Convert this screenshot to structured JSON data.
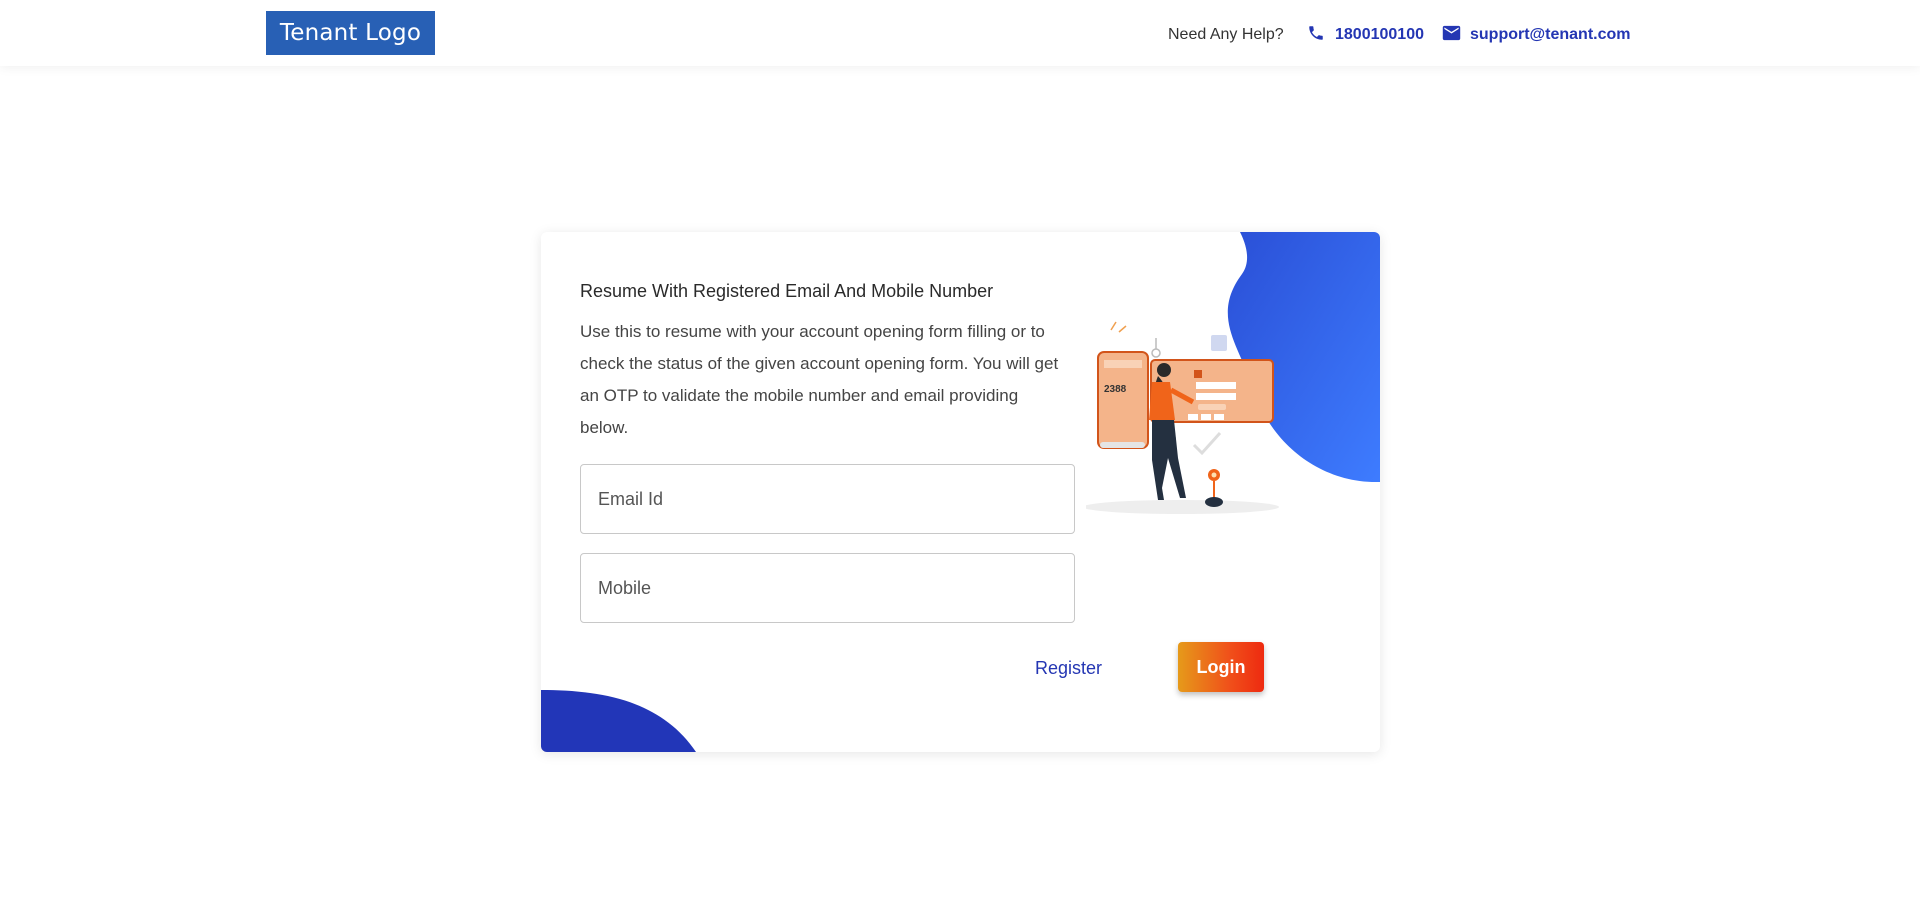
{
  "header": {
    "logo_text": "Tenant Logo",
    "help_text": "Need Any Help?",
    "phone": "1800100100",
    "email": "support@tenant.com",
    "phone_icon": "phone-icon",
    "mail_icon": "mail-icon"
  },
  "card": {
    "title": "Resume With Registered Email And Mobile Number",
    "description": "Use this to resume with your account opening form filling or to check the status of the given account opening form. You will get an OTP to validate the mobile number and email providing below.",
    "email_placeholder": "Email Id",
    "mobile_placeholder": "Mobile",
    "register_label": "Register",
    "login_label": "Login",
    "illustration_code": "2388"
  },
  "colors": {
    "brand_blue": "#2860b5",
    "link_blue": "#2436b3",
    "login_gradient_start": "#e69a1a",
    "login_gradient_end": "#ee2a10",
    "blob_blue": "#3a6af2"
  }
}
